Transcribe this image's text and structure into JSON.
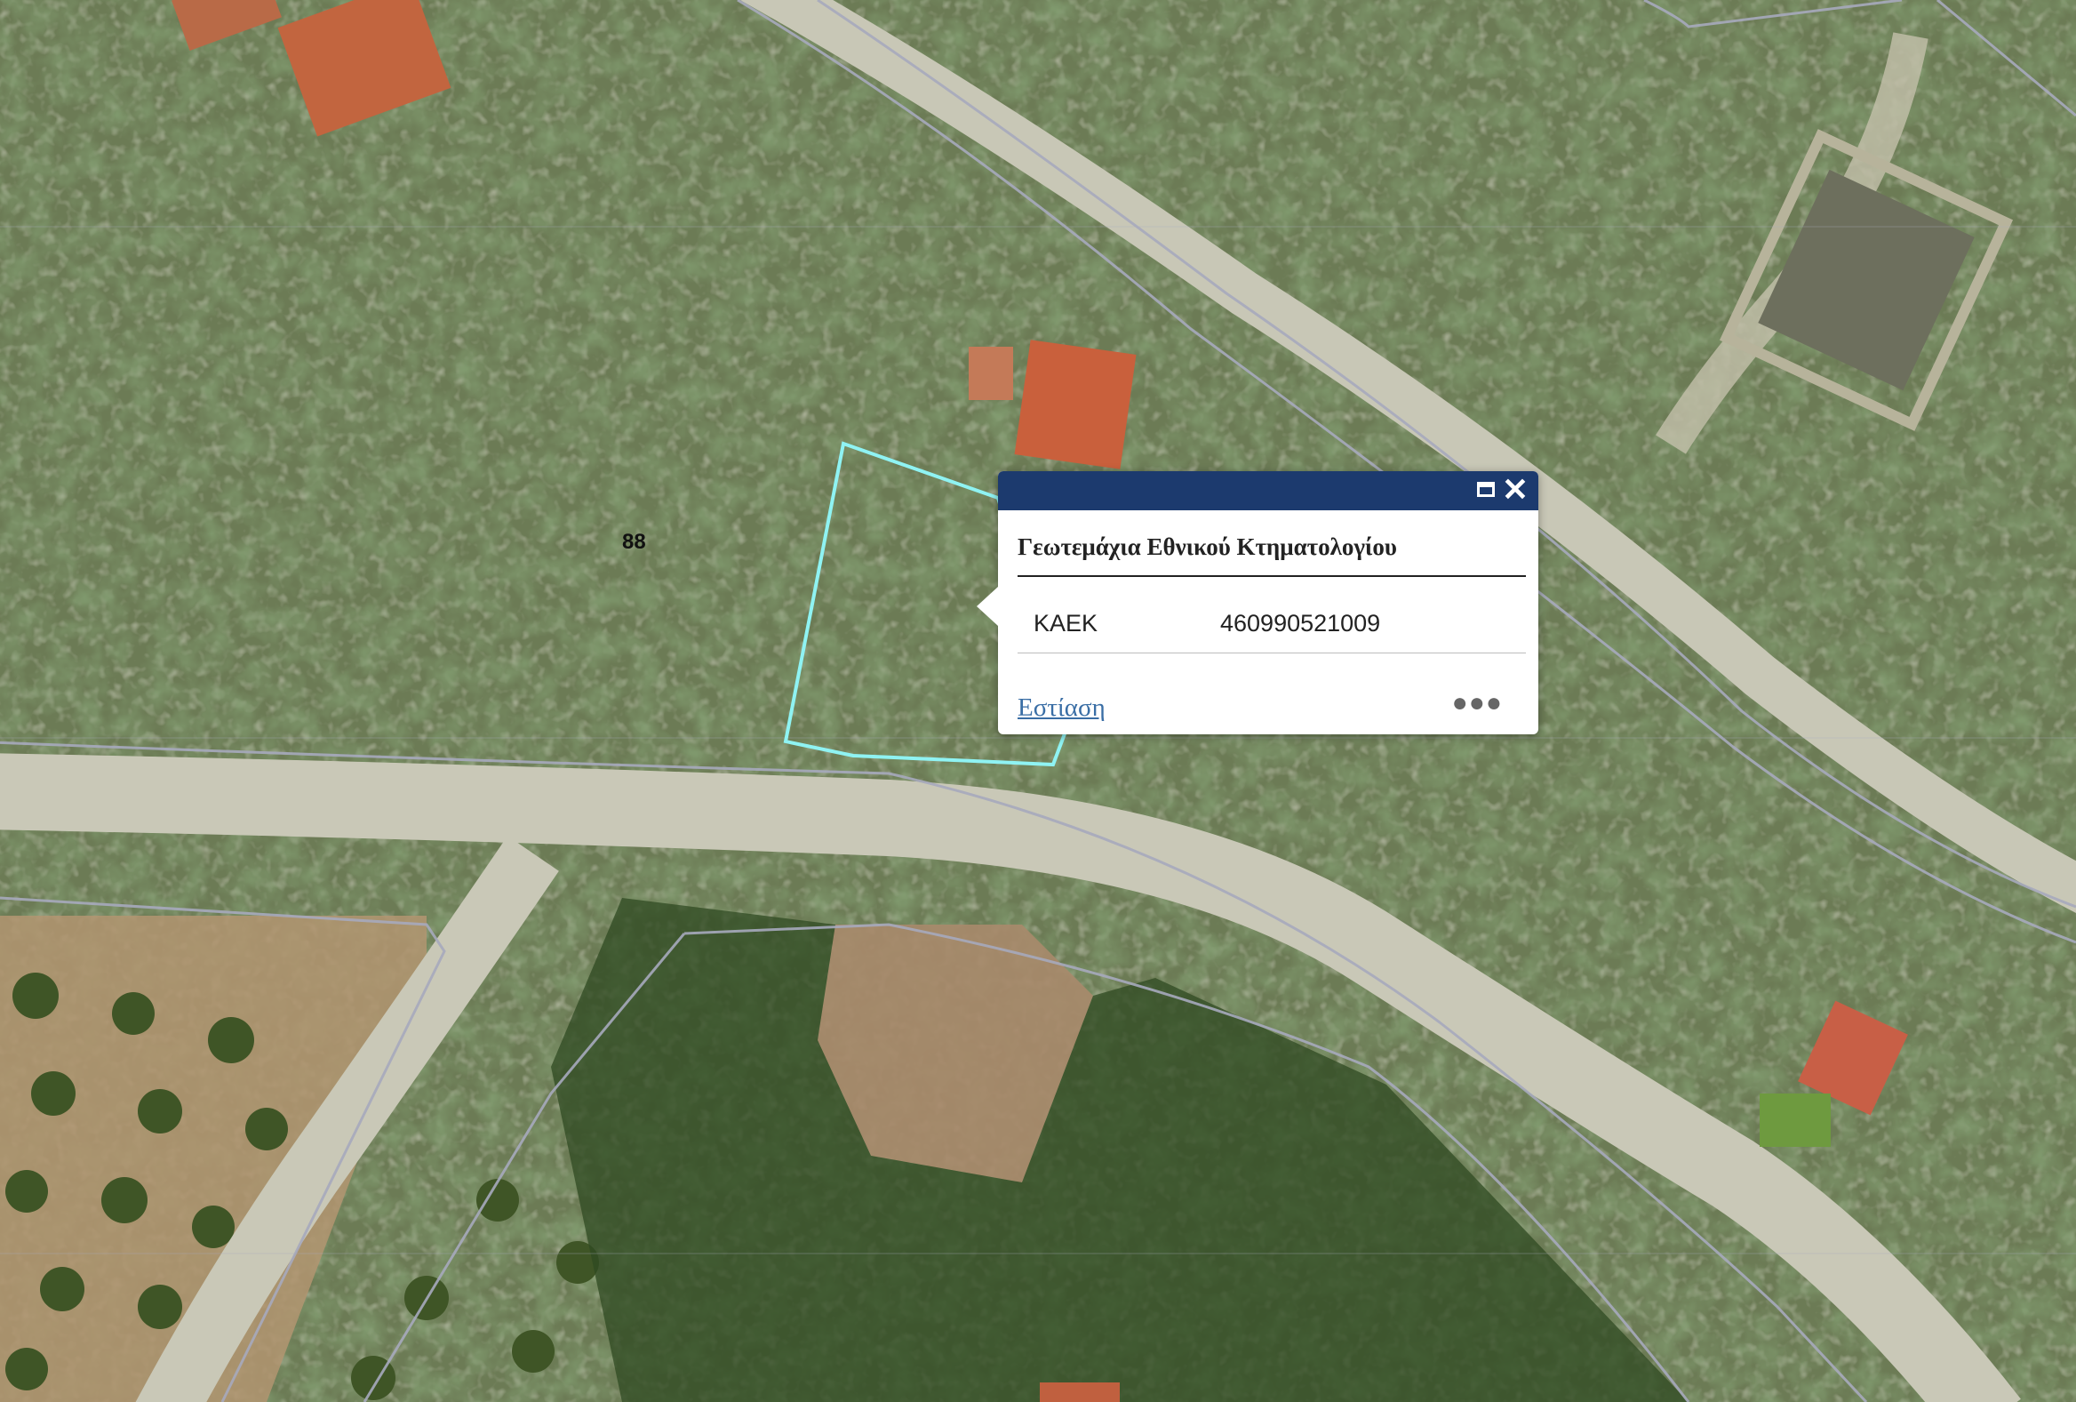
{
  "map": {
    "parcel_label": "88",
    "selected_parcel_color": "#8ff3f3",
    "boundary_color": "#a7aabd"
  },
  "popup": {
    "title": "Γεωτεμάχια Εθνικού Κτηματολογίου",
    "attributes": [
      {
        "key": "ΚΑΕΚ",
        "value": "460990521009"
      }
    ],
    "zoom_link": "Εστίαση",
    "more_icon": "ellipsis-icon",
    "maximize_icon": "maximize-icon",
    "close_icon": "close-icon",
    "header_color": "#1c3a6e"
  }
}
